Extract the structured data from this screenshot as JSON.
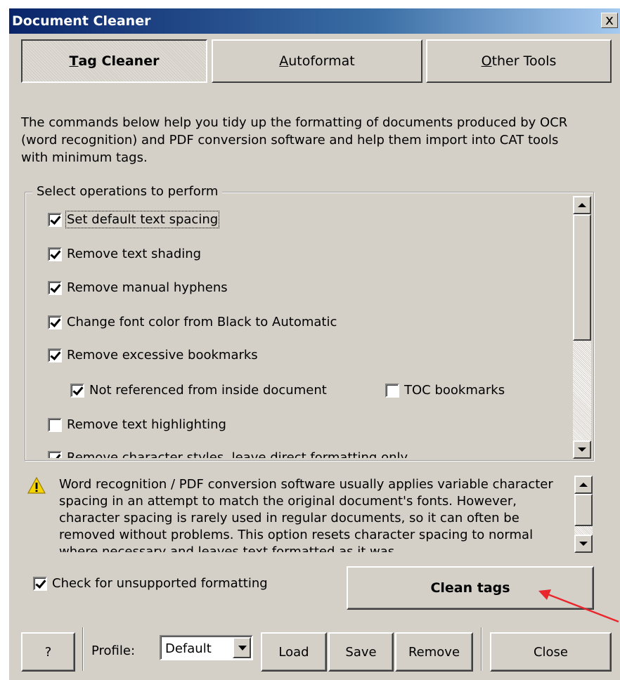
{
  "window": {
    "title": "Document Cleaner",
    "close_glyph": "x"
  },
  "tabs": [
    {
      "label": "Tag Cleaner",
      "mnemonic": "T",
      "rest": "ag Cleaner",
      "active": true
    },
    {
      "label": "Autoformat",
      "mnemonic": "A",
      "rest": "utoformat",
      "active": false
    },
    {
      "label": "Other Tools",
      "mnemonic": "O",
      "rest": "ther Tools",
      "active": false
    }
  ],
  "description": "The commands below help you tidy up the formatting of documents produced by OCR (word recognition) and PDF conversion software and help them import into CAT tools with minimum tags.",
  "operations": {
    "legend": "Select operations to perform",
    "items": [
      {
        "label": "Set default text spacing",
        "checked": true
      },
      {
        "label": "Remove text shading",
        "checked": true
      },
      {
        "label": "Remove manual hyphens",
        "checked": true
      },
      {
        "label": "Change font color from Black to Automatic",
        "checked": true
      },
      {
        "label": "Remove excessive bookmarks",
        "checked": true
      },
      {
        "label": "Not referenced from inside document",
        "checked": true
      },
      {
        "label": "TOC bookmarks",
        "checked": false
      },
      {
        "label": "Remove text highlighting",
        "checked": false
      },
      {
        "label": "Remove character styles, leave direct formatting only",
        "checked": true
      }
    ]
  },
  "warning": {
    "icon": "warning-icon",
    "text": "Word recognition / PDF conversion software usually applies variable character spacing in an attempt to match the original document's fonts. However, character spacing is rarely used in regular documents, so it can often be removed without problems. This option resets character spacing to normal where necessary and leaves text formatted as it was."
  },
  "check_unsupported": {
    "label": "Check for unsupported formatting",
    "checked": true
  },
  "clean_button": "Clean tags",
  "footer": {
    "help": "?",
    "profile_label": "Profile:",
    "profile_value": "Default",
    "load": "Load",
    "save": "Save",
    "remove": "Remove",
    "close": "Close"
  },
  "colors": {
    "annotation_arrow": "#e8262b",
    "title_gradient_start": "#0a246a"
  }
}
